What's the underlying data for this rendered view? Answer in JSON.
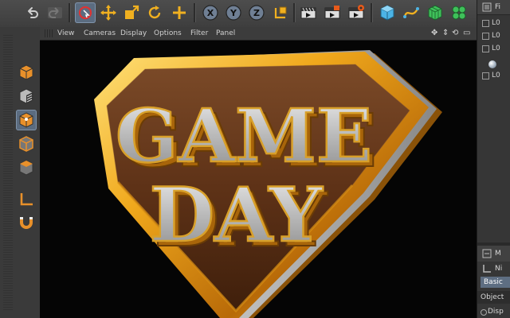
{
  "toolbar": {
    "buttons": [
      {
        "name": "undo-icon",
        "active": false
      },
      {
        "name": "redo-icon",
        "active": false
      },
      {
        "name": "live-selection-icon",
        "active": true
      },
      {
        "name": "move-icon",
        "active": false
      },
      {
        "name": "scale-icon",
        "active": false
      },
      {
        "name": "rotate-icon",
        "active": false
      },
      {
        "name": "add-icon",
        "active": false
      },
      {
        "name": "x-axis-icon",
        "label": "X"
      },
      {
        "name": "y-axis-icon",
        "label": "Y"
      },
      {
        "name": "z-axis-icon",
        "label": "Z"
      },
      {
        "name": "coordinate-system-icon"
      },
      {
        "name": "render-view-icon"
      },
      {
        "name": "render-picture-viewer-icon"
      },
      {
        "name": "render-settings-icon"
      },
      {
        "name": "cube-icon"
      },
      {
        "name": "spline-pen-icon"
      },
      {
        "name": "subdivision-surface-icon"
      },
      {
        "name": "cloner-icon"
      }
    ]
  },
  "leftbar": {
    "tools": [
      {
        "name": "make-editable-icon",
        "active": false
      },
      {
        "name": "model-mode-icon",
        "active": false
      },
      {
        "name": "object-mode-icon",
        "active": true
      },
      {
        "name": "points-mode-icon",
        "active": false
      },
      {
        "name": "polygons-mode-icon",
        "active": false
      },
      {
        "name": "axis-icon",
        "active": false
      },
      {
        "name": "magnet-icon",
        "active": false
      }
    ]
  },
  "viewport": {
    "menu": [
      "View",
      "Cameras",
      "Display",
      "Options",
      "Filter",
      "Panel"
    ],
    "nav_icons": [
      "move-view-icon",
      "zoom-view-icon",
      "rotate-view-icon",
      "toggle-layout-icon"
    ],
    "scene_text": {
      "line1": "GAME",
      "line2": "DAY"
    }
  },
  "object_manager": {
    "header_label": "Fi",
    "tree_items": [
      {
        "label": "L0"
      },
      {
        "label": "L0"
      },
      {
        "label": "L0"
      },
      {
        "label": "L0"
      }
    ]
  },
  "attributes": {
    "header_label": "M",
    "row1_label": "Ni",
    "tab_basic": "Basic",
    "object_label": "Object",
    "display_label": "Disp"
  },
  "colors": {
    "accent_selected": "#5b6c80",
    "axis_button": "#b44",
    "gold": "#e8a21b",
    "brown_plate": "#6b3a1a",
    "letter_face": "#c9c9c9"
  }
}
